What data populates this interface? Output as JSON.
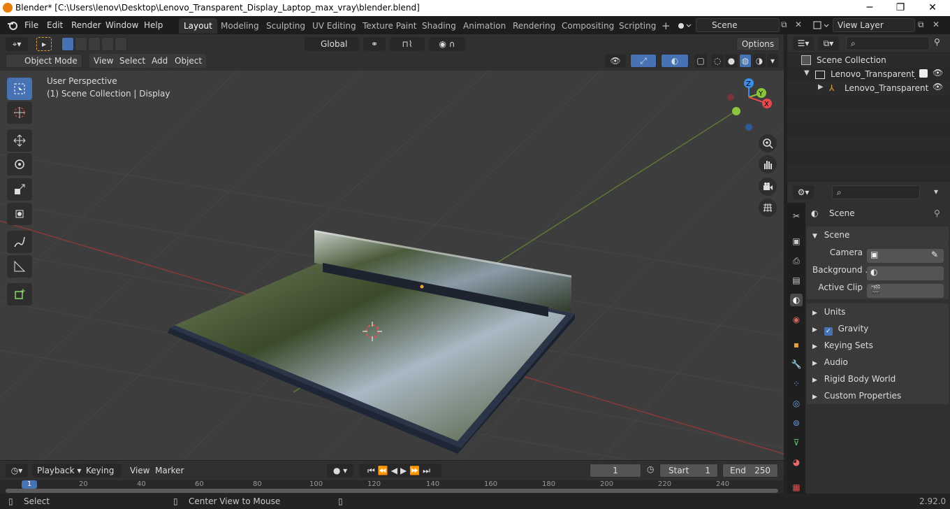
{
  "window": {
    "title": "Blender* [C:\\Users\\lenov\\Desktop\\Lenovo_Transparent_Display_Laptop_max_vray\\blender.blend]",
    "min": "─",
    "max": "❐",
    "close": "✕"
  },
  "menubar": {
    "items": [
      "File",
      "Edit",
      "Render",
      "Window",
      "Help"
    ]
  },
  "workspaces": [
    "Layout",
    "Modeling",
    "Sculpting",
    "UV Editing",
    "Texture Paint",
    "Shading",
    "Animation",
    "Rendering",
    "Compositing",
    "Scripting"
  ],
  "workspace_add": "+",
  "scene_field": "Scene",
  "view_layer_field": "View Layer",
  "header": {
    "orientation": "Global",
    "options": "Options",
    "mode": "Object Mode",
    "menus": [
      "View",
      "Select",
      "Add",
      "Object"
    ]
  },
  "viewport": {
    "perspective": "User Perspective",
    "collection_info": "(1) Scene Collection | Display",
    "gizmo": {
      "z": "Z",
      "y": "Y",
      "x": "X"
    }
  },
  "outliner": {
    "root": "Scene Collection",
    "collection": "Lenovo_Transparent_Disp",
    "object": "Lenovo_Transparent_"
  },
  "properties": {
    "context": "Scene",
    "section": "Scene",
    "camera_label": "Camera",
    "background_label": "Background ...",
    "active_clip_label": "Active Clip",
    "panels": [
      "Units",
      "Gravity",
      "Keying Sets",
      "Audio",
      "Rigid Body World",
      "Custom Properties"
    ],
    "gravity_checked": true
  },
  "timeline": {
    "menus": [
      "Playback",
      "Keying",
      "View",
      "Marker"
    ],
    "current_frame": "1",
    "start_label": "Start",
    "start_value": "1",
    "end_label": "End",
    "end_value": "250",
    "ruler": [
      "1",
      "20",
      "40",
      "60",
      "80",
      "100",
      "120",
      "140",
      "160",
      "180",
      "200",
      "220",
      "240"
    ]
  },
  "statusbar": {
    "select": "Select",
    "center": "Center View to Mouse",
    "version": "2.92.0"
  },
  "colors": {
    "accent_blue": "#4772b3",
    "x_axis": "#e5484d",
    "y_axis": "#8cc43c",
    "z_axis": "#3d8ee8",
    "title_bar": "#ffffff"
  }
}
